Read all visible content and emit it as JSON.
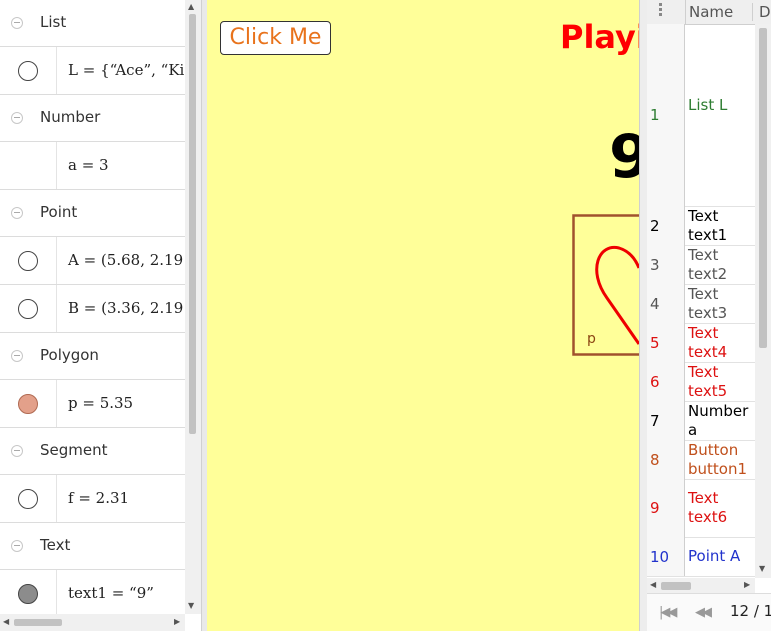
{
  "algebra": {
    "groups": [
      {
        "header": "List",
        "items": [
          {
            "expr": "L = {“Ace”, “Ki",
            "marble": "empty"
          }
        ]
      },
      {
        "header": "Number",
        "items": [
          {
            "expr": "a = 3",
            "marble": "none"
          }
        ]
      },
      {
        "header": "Point",
        "items": [
          {
            "expr": "A = (5.68,  2.19",
            "marble": "empty"
          },
          {
            "expr": "B = (3.36,  2.19",
            "marble": "empty"
          }
        ]
      },
      {
        "header": "Polygon",
        "items": [
          {
            "expr": "p = 5.35",
            "marble": "salmon"
          }
        ]
      },
      {
        "header": "Segment",
        "items": [
          {
            "expr": "f = 2.31",
            "marble": "empty"
          }
        ]
      },
      {
        "header": "Text",
        "items": [
          {
            "expr": "text1 = “9”",
            "marble": "gray"
          }
        ]
      }
    ]
  },
  "graphics": {
    "button_label": "Click Me",
    "title": "Playi",
    "big_number": "9",
    "polygon_label": "p"
  },
  "spreadsheet": {
    "col_headers": [
      "Name",
      "D"
    ],
    "rows": [
      {
        "num": "1",
        "cell": "List L",
        "color": "#2e7d32"
      },
      {
        "num": "2",
        "cell": "Text\ntext1",
        "color": "#000000"
      },
      {
        "num": "3",
        "cell": "Text\ntext2",
        "color": "#555555"
      },
      {
        "num": "4",
        "cell": "Text\ntext3",
        "color": "#555555"
      },
      {
        "num": "5",
        "cell": "Text\ntext4",
        "color": "#dd1111"
      },
      {
        "num": "6",
        "cell": "Text\ntext5",
        "color": "#dd1111"
      },
      {
        "num": "7",
        "cell": "Number\na",
        "color": "#000000"
      },
      {
        "num": "8",
        "cell": "Button\nbutton1",
        "color": "#c0501c"
      },
      {
        "num": "9",
        "cell": "Text\ntext6",
        "color": "#dd1111"
      },
      {
        "num": "10",
        "cell": "Point A",
        "color": "#2233cc"
      }
    ],
    "page_indicator": "12 / 1"
  },
  "colors": {
    "graphics_bg": "#ffff99",
    "title_red": "#ff0000",
    "button_text": "#e8731c",
    "polygon_stroke": "#a0522d",
    "heart_stroke": "#ee0000"
  }
}
